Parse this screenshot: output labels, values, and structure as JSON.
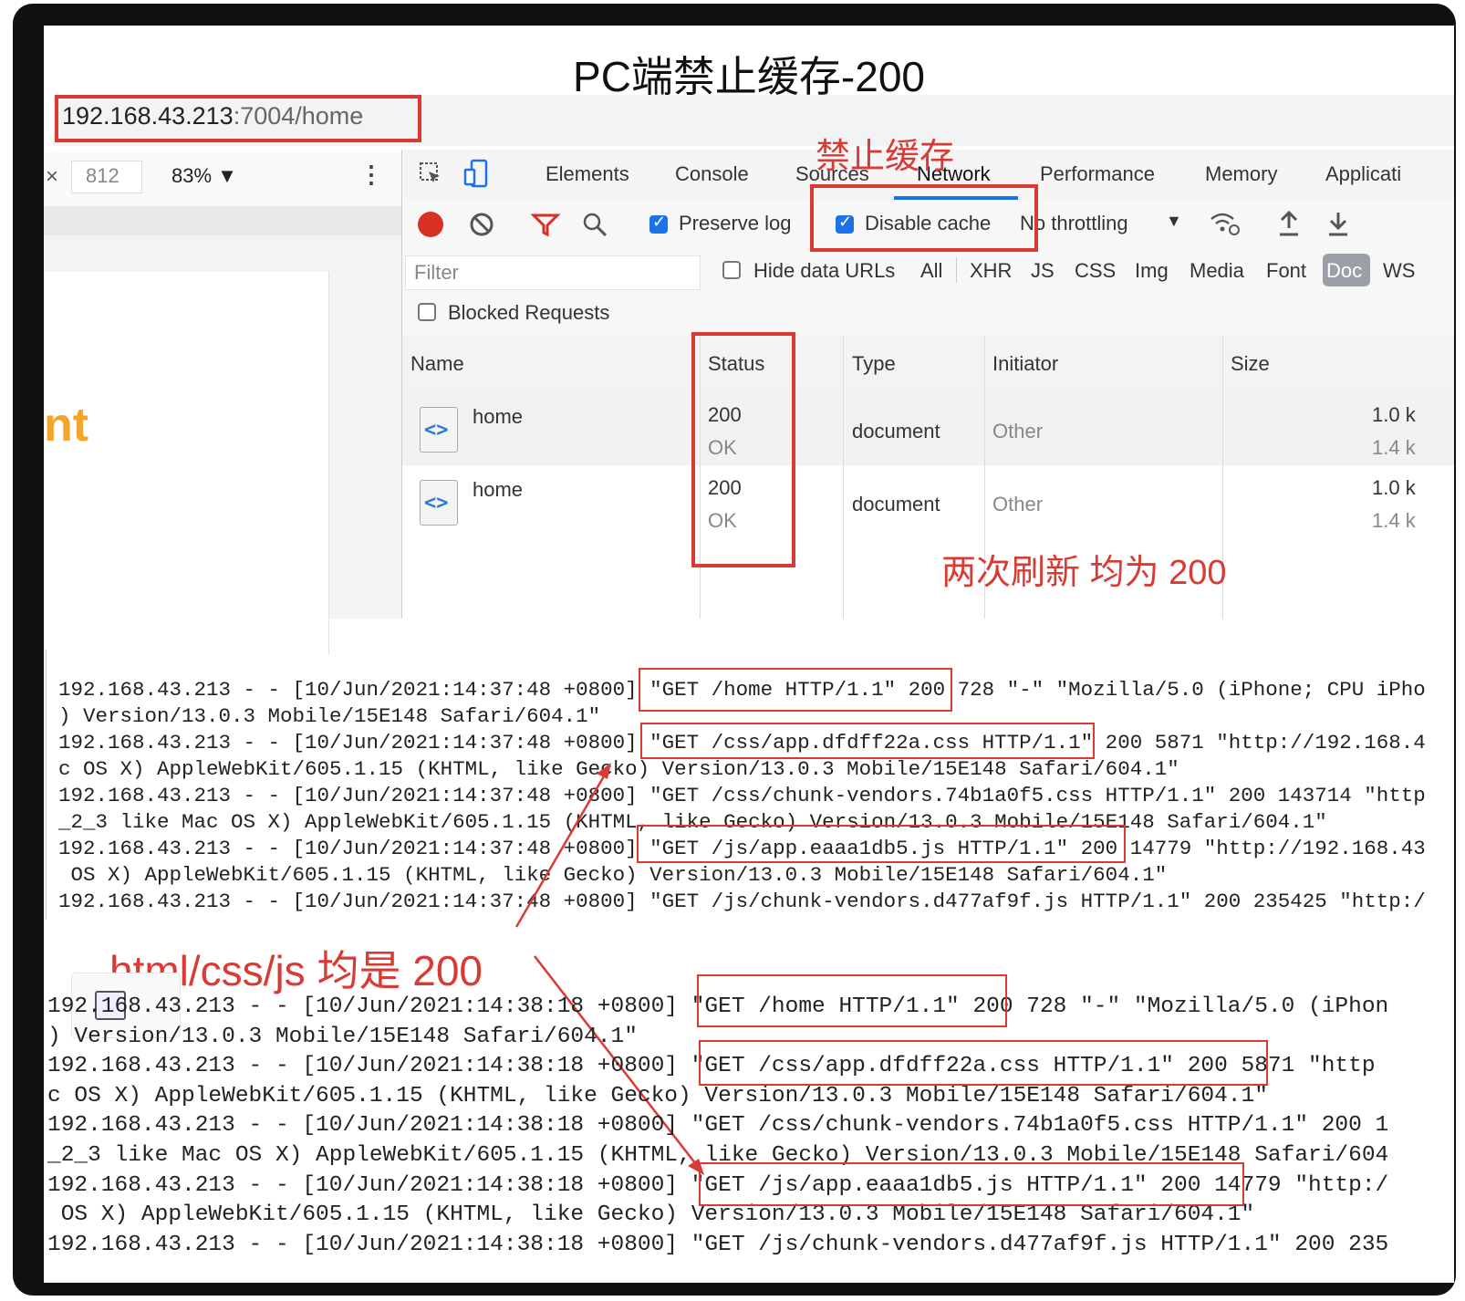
{
  "title": "PC端禁止缓存-200",
  "url": {
    "host": "192.168.43.213",
    "rest": ":7004/home"
  },
  "left_panel": {
    "close": "×",
    "width": "812",
    "zoom": "83% ▼",
    "more": "⋮",
    "partial_text": "nt"
  },
  "devtools": {
    "tabs": [
      "Elements",
      "Console",
      "Sources",
      "Network",
      "Performance",
      "Memory",
      "Applicati"
    ],
    "toolbar": {
      "preserve_log": "Preserve log",
      "disable_cache": "Disable cache",
      "throttling": "No throttling",
      "throttling_arrow": "▼"
    },
    "filter": {
      "placeholder": "Filter",
      "hide_data_urls": "Hide data URLs",
      "types": [
        "All",
        "XHR",
        "JS",
        "CSS",
        "Img",
        "Media",
        "Font",
        "Doc",
        "WS"
      ],
      "blocked": "Blocked Requests"
    },
    "columns": [
      "Name",
      "Status",
      "Type",
      "Initiator",
      "Size"
    ],
    "rows": [
      {
        "name": "home",
        "status": "200",
        "status_text": "OK",
        "type": "document",
        "initiator": "Other",
        "size1": "1.0 k",
        "size2": "1.4 k"
      },
      {
        "name": "home",
        "status": "200",
        "status_text": "OK",
        "type": "document",
        "initiator": "Other",
        "size1": "1.0 k",
        "size2": "1.4 k"
      }
    ]
  },
  "annotations": {
    "disable_cache_label": "禁止缓存",
    "refresh_note": "两次刷新 均为 200",
    "assets_note": "html/css/js 均是 200"
  },
  "log1": [
    "192.168.43.213 - - [10/Jun/2021:14:37:48 +0800] \"GET /home HTTP/1.1\" 200 728 \"-\" \"Mozilla/5.0 (iPhone; CPU iPho",
    ") Version/13.0.3 Mobile/15E148 Safari/604.1\"",
    "192.168.43.213 - - [10/Jun/2021:14:37:48 +0800] \"GET /css/app.dfdff22a.css HTTP/1.1\" 200 5871 \"http://192.168.4",
    "c OS X) AppleWebKit/605.1.15 (KHTML, like Gecko) Version/13.0.3 Mobile/15E148 Safari/604.1\"",
    "192.168.43.213 - - [10/Jun/2021:14:37:48 +0800] \"GET /css/chunk-vendors.74b1a0f5.css HTTP/1.1\" 200 143714 \"http",
    "_2_3 like Mac OS X) AppleWebKit/605.1.15 (KHTML, like Gecko) Version/13.0.3 Mobile/15E148 Safari/604.1\"",
    "192.168.43.213 - - [10/Jun/2021:14:37:48 +0800] \"GET /js/app.eaaa1db5.js HTTP/1.1\" 200 14779 \"http://192.168.43",
    " OS X) AppleWebKit/605.1.15 (KHTML, like Gecko) Version/13.0.3 Mobile/15E148 Safari/604.1\"",
    "192.168.43.213 - - [10/Jun/2021:14:37:48 +0800] \"GET /js/chunk-vendors.d477af9f.js HTTP/1.1\" 200 235425 \"http:/"
  ],
  "log2": [
    "192.168.43.213 - - [10/Jun/2021:14:38:18 +0800] \"GET /home HTTP/1.1\" 200 728 \"-\" \"Mozilla/5.0 (iPhon",
    ") Version/13.0.3 Mobile/15E148 Safari/604.1\"",
    "192.168.43.213 - - [10/Jun/2021:14:38:18 +0800] \"GET /css/app.dfdff22a.css HTTP/1.1\" 200 5871 \"http",
    "c OS X) AppleWebKit/605.1.15 (KHTML, like Gecko) Version/13.0.3 Mobile/15E148 Safari/604.1\"",
    "192.168.43.213 - - [10/Jun/2021:14:38:18 +0800] \"GET /css/chunk-vendors.74b1a0f5.css HTTP/1.1\" 200 1",
    "_2_3 like Mac OS X) AppleWebKit/605.1.15 (KHTML, like Gecko) Version/13.0.3 Mobile/15E148 Safari/604",
    "192.168.43.213 - - [10/Jun/2021:14:38:18 +0800] \"GET /js/app.eaaa1db5.js HTTP/1.1\" 200 14779 \"http:/",
    " OS X) AppleWebKit/605.1.15 (KHTML, like Gecko) Version/13.0.3 Mobile/15E148 Safari/604.1\"",
    "192.168.43.213 - - [10/Jun/2021:14:38:18 +0800] \"GET /js/chunk-vendors.d477af9f.js HTTP/1.1\" 200 235"
  ],
  "colors": {
    "accent_red": "#d93a33",
    "checkbox_blue": "#1a73e8",
    "record_red": "#d93025",
    "orange": "#f4a52a"
  }
}
